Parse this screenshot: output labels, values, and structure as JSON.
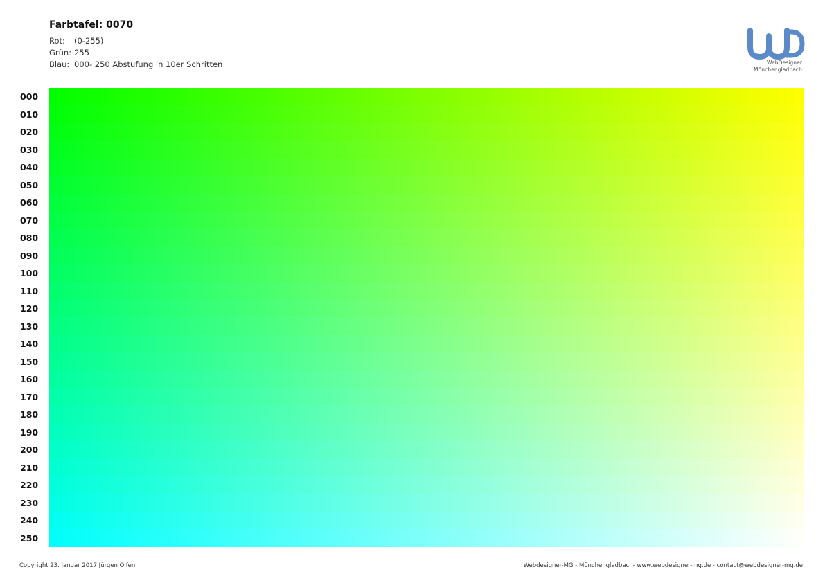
{
  "header": {
    "title": "Farbtafel: 0070",
    "red_label": "Rot:",
    "red_value": "(0-255)",
    "green_label": "Grün:",
    "green_value": "255",
    "blue_label": "Blau:",
    "blue_value": "000- 250 Abstufung in 10er Schritten"
  },
  "logo": {
    "mark": "WD",
    "line1": "WebDesigner",
    "line2": "Mönchengladbach",
    "color": "#5b8ac8"
  },
  "chart_data": {
    "type": "heatmap",
    "title": "Farbtafel: 0070",
    "green_fixed": 255,
    "red_range": [
      0,
      255
    ],
    "blue_values": [
      0,
      10,
      20,
      30,
      40,
      50,
      60,
      70,
      80,
      90,
      100,
      110,
      120,
      130,
      140,
      150,
      160,
      170,
      180,
      190,
      200,
      210,
      220,
      230,
      240,
      250
    ],
    "row_labels": [
      "000",
      "010",
      "020",
      "030",
      "040",
      "050",
      "060",
      "070",
      "080",
      "090",
      "100",
      "110",
      "120",
      "130",
      "140",
      "150",
      "160",
      "170",
      "180",
      "190",
      "200",
      "210",
      "220",
      "230",
      "240",
      "250"
    ]
  },
  "footer": {
    "left": "Copyright 23. Januar 2017 Jürgen Olfen",
    "right": "Webdesigner-MG - Mönchengladbach- www.webdesigner-mg.de - contact@webdesigner-mg.de"
  }
}
